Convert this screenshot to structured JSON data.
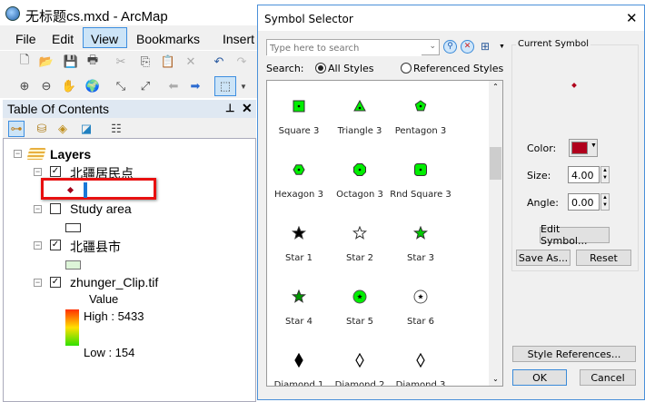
{
  "app": {
    "title": "无标题cs.mxd - ArcMap"
  },
  "menu": [
    "File",
    "Edit",
    "View",
    "Bookmarks",
    "Insert"
  ],
  "menu_active": "View",
  "toc": {
    "title": "Table Of Contents",
    "root": "Layers",
    "layers": [
      {
        "name": "北疆居民点",
        "checked": true,
        "symbol": "point",
        "symbol_color": "#a0001a"
      },
      {
        "name": "Study area",
        "checked": false,
        "symbol": "polygon",
        "symbol_color": "#ffffff"
      },
      {
        "name": "北疆县市",
        "checked": true,
        "symbol": "polygon",
        "symbol_color": "#ddf5d8"
      },
      {
        "name": "zhunger_Clip.tif",
        "checked": true,
        "symbol": "ramp"
      }
    ],
    "raster_legend": {
      "field": "Value",
      "high": "High : 5433",
      "low": "Low : 154"
    }
  },
  "dialog": {
    "title": "Symbol Selector",
    "search_placeholder": "Type here to search",
    "search_label": "Search:",
    "radio_all": "All Styles",
    "radio_ref": "Referenced Styles",
    "radio_selected": "All Styles",
    "symbols": [
      {
        "label": "Square 3",
        "shape": "square",
        "fill": "#00ee00"
      },
      {
        "label": "Triangle 3",
        "shape": "triangle",
        "fill": "#00ee00"
      },
      {
        "label": "Pentagon 3",
        "shape": "pentagon",
        "fill": "#00ee00"
      },
      {
        "label": "Hexagon 3",
        "shape": "hexagon",
        "fill": "#00ee00"
      },
      {
        "label": "Octagon 3",
        "shape": "octagon",
        "fill": "#00ee00"
      },
      {
        "label": "Rnd Square 3",
        "shape": "rndsquare",
        "fill": "#00ee00"
      },
      {
        "label": "Star 1",
        "shape": "star",
        "fill": "#000000"
      },
      {
        "label": "Star 2",
        "shape": "star",
        "fill": "#ffffff"
      },
      {
        "label": "Star 3",
        "shape": "star",
        "fill": "#00cc00"
      },
      {
        "label": "Star 4",
        "shape": "star",
        "fill": "#009900"
      },
      {
        "label": "Star 5",
        "shape": "circlestar",
        "fill": "#00ee00"
      },
      {
        "label": "Star 6",
        "shape": "circlestar",
        "fill": "#ffffff"
      },
      {
        "label": "Diamond 1",
        "shape": "diamond",
        "fill": "#000000"
      },
      {
        "label": "Diamond 2",
        "shape": "diamond",
        "fill": "#ffffff"
      },
      {
        "label": "Diamond 3",
        "shape": "diamond",
        "fill": "#ffffff"
      }
    ],
    "current_symbol": {
      "group_label": "Current Symbol",
      "color_label": "Color:",
      "color": "#b0001c",
      "size_label": "Size:",
      "size": "4.00",
      "angle_label": "Angle:",
      "angle": "0.00"
    },
    "buttons": {
      "edit": "Edit Symbol...",
      "save": "Save As...",
      "reset": "Reset",
      "style_refs": "Style References...",
      "ok": "OK",
      "cancel": "Cancel"
    }
  }
}
